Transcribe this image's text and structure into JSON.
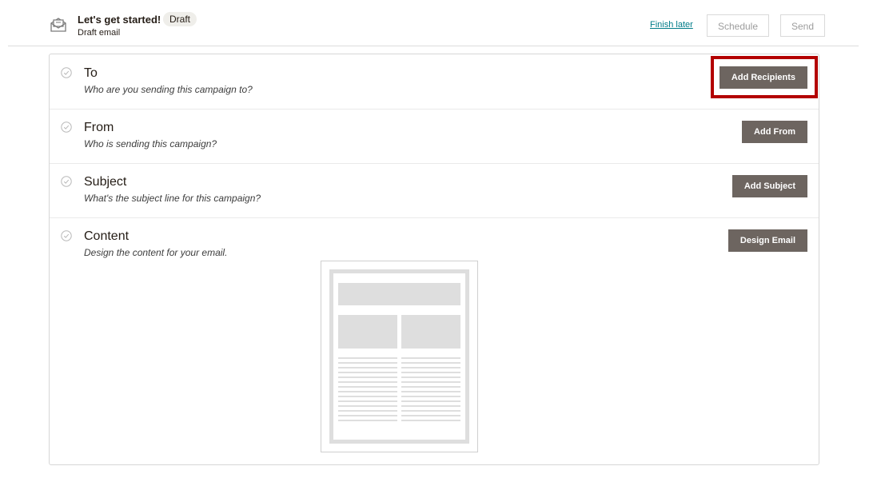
{
  "header": {
    "title": "Let's get started!",
    "status_badge": "Draft",
    "subtitle": "Draft email",
    "finish_later": "Finish later",
    "schedule_label": "Schedule",
    "send_label": "Send",
    "icon": "email-campaign-icon"
  },
  "sections": [
    {
      "title": "To",
      "description": "Who are you sending this campaign to?",
      "button": "Add Recipients"
    },
    {
      "title": "From",
      "description": "Who is sending this campaign?",
      "button": "Add From"
    },
    {
      "title": "Subject",
      "description": "What's the subject line for this campaign?",
      "button": "Add Subject"
    },
    {
      "title": "Content",
      "description": "Design the content for your email.",
      "button": "Design Email"
    }
  ],
  "colors": {
    "action_button": "#6d6560",
    "link": "#007c89",
    "highlight": "#b30000"
  }
}
